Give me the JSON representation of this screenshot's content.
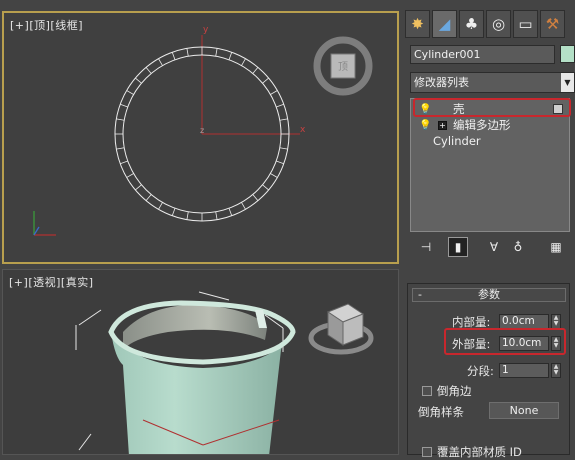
{
  "viewport_top": {
    "label": [
      "[+]",
      "[顶]",
      "[线框]"
    ],
    "axis_x": "x",
    "axis_y": "y",
    "axis_z": "z"
  },
  "viewport_persp": {
    "label": [
      "[+]",
      "[透视]",
      "[真实]"
    ]
  },
  "command_panel": {
    "tabs": [
      "create-icon",
      "modify-icon",
      "hierarchy-icon",
      "motion-icon",
      "display-icon",
      "utilities-icon"
    ],
    "object_name": "Cylinder001",
    "object_color": "#b4e0c7",
    "modifier_list": "修改器列表",
    "stack": [
      {
        "label": "壳",
        "highlighted": true
      },
      {
        "label": "编辑多边形",
        "highlighted": false
      },
      {
        "label": "Cylinder",
        "highlighted": false
      }
    ]
  },
  "parameters": {
    "title": "参数",
    "inner_amount_label": "内部量:",
    "inner_amount_value": "0.0cm",
    "outer_amount_label": "外部量:",
    "outer_amount_value": "10.0cm",
    "segments_label": "分段:",
    "segments_value": "1",
    "bevel_edges_label": "倒角边",
    "bevel_spline_label": "倒角样条",
    "bevel_spline_button": "None",
    "override_inner_mat_label": "覆盖内部材质 ID"
  },
  "accent_colors": {
    "highlight_box": "#c8272d",
    "active_viewport_border": "#b89f4e"
  }
}
